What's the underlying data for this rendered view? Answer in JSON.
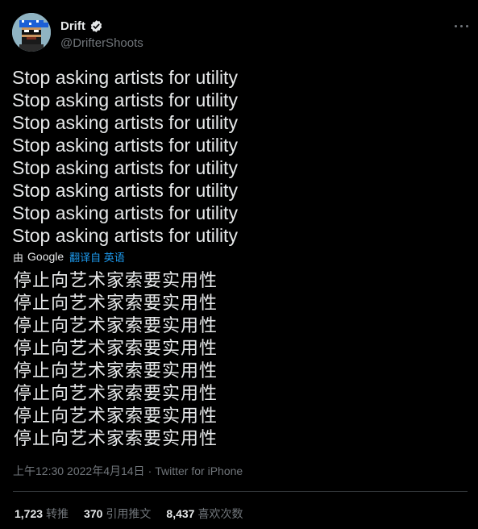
{
  "author": {
    "display_name": "Drift",
    "handle": "@DrifterShoots",
    "verified_icon": "verified-badge-icon",
    "avatar_icon": "pixel-art-avatar"
  },
  "tweet": {
    "english_lines": [
      "Stop asking artists for utility",
      "Stop asking artists for utility",
      "Stop asking artists for utility",
      "Stop asking artists for utility",
      "Stop asking artists for utility",
      "Stop asking artists for utility",
      "Stop asking artists for utility",
      "Stop asking artists for utility"
    ],
    "translation": {
      "by_label": "由",
      "provider": "Google",
      "translated_from": "翻译自 英语"
    },
    "chinese_lines": [
      "停止向艺术家索要实用性",
      "停止向艺术家索要实用性",
      "停止向艺术家索要实用性",
      "停止向艺术家索要实用性",
      "停止向艺术家索要实用性",
      "停止向艺术家索要实用性",
      "停止向艺术家索要实用性",
      "停止向艺术家索要实用性"
    ],
    "time": "上午12:30",
    "separator": "·",
    "date": "2022年4月14日",
    "source": "Twitter for iPhone"
  },
  "stats": {
    "retweets_count": "1,723",
    "retweets_label": "转推",
    "quotes_count": "370",
    "quotes_label": "引用推文",
    "likes_count": "8,437",
    "likes_label": "喜欢次数"
  },
  "colors": {
    "background": "#000000",
    "text": "#e7e9ea",
    "secondary": "#71767b",
    "link": "#1d9bf0",
    "divider": "#2f3336"
  }
}
